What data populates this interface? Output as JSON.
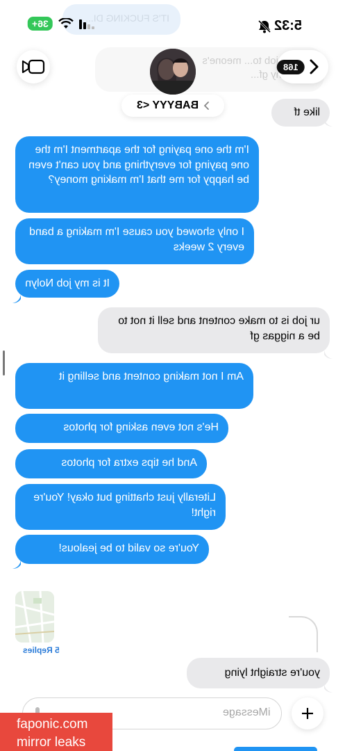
{
  "status_bar": {
    "time": "5:32",
    "battery": "36+",
    "ghost_top_text": "IT'S FUCKING DI..."
  },
  "ghost_message": "e. your job to... meone's\nbeing my gf...",
  "header": {
    "contact_name": "BABYYY <3",
    "unread_count": "168"
  },
  "messages": [
    {
      "side": "received",
      "text": "like tf"
    },
    {
      "side": "sent",
      "text": "I'm the one paying for the apartment I'm the one paying for everything and you can't even be happy for me that I'm making money?"
    },
    {
      "side": "sent",
      "text": "I only showed you cause I'm making a band every 2 weeks"
    },
    {
      "side": "sent",
      "text": "It is my job Nolyn"
    },
    {
      "side": "received",
      "text": "ur job is to make content and sell it not to be a niggas gf"
    },
    {
      "side": "sent",
      "text": "Am I not making content and selling it"
    },
    {
      "side": "sent",
      "text": "He's not even asking for photos"
    },
    {
      "side": "sent",
      "text": "And he tips extra for photos"
    },
    {
      "side": "sent",
      "text": "Literally just chatting but okay! You're right!"
    },
    {
      "side": "sent",
      "text": "You're so valid to be jealous!"
    },
    {
      "side": "received",
      "text": "you're straight lying"
    }
  ],
  "thread": {
    "replies_label": "5 Replies"
  },
  "composer": {
    "placeholder": "iMessage"
  },
  "watermark": {
    "line1": "faponic.com",
    "line2": "mirror leaks"
  },
  "colors": {
    "sent_bubble": "#2094f3",
    "received_bubble": "#e9e9eb",
    "watermark": "#e8483d"
  }
}
